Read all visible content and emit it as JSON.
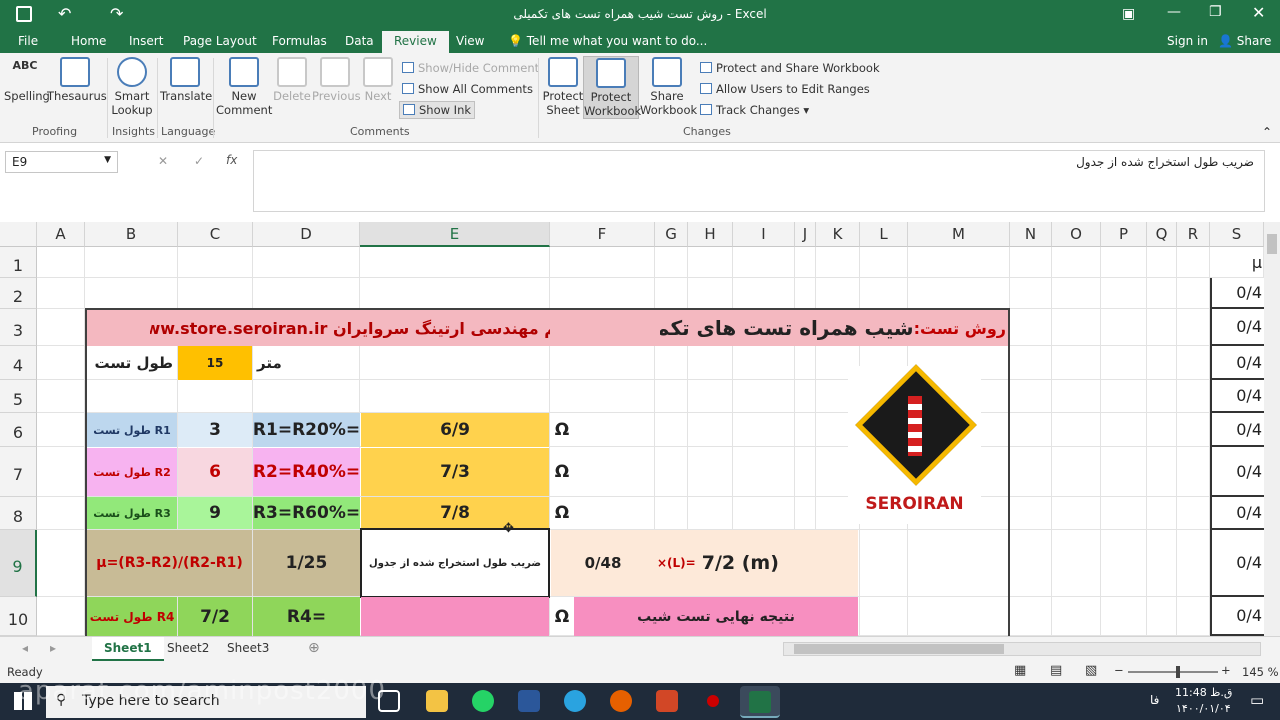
{
  "title": "روش تست شیب همراه تست های تکمیلی - Excel",
  "tabs": [
    "File",
    "Home",
    "Insert",
    "Page Layout",
    "Formulas",
    "Data",
    "Review",
    "View"
  ],
  "tell_me": "Tell me what you want to do...",
  "sign_in": "Sign in",
  "share": "Share",
  "ribbon": {
    "spelling": "Spelling",
    "thesaurus": "Thesaurus",
    "smart_lookup_1": "Smart",
    "smart_lookup_2": "Lookup",
    "translate": "Translate",
    "new_comment_1": "New",
    "new_comment_2": "Comment",
    "delete": "Delete",
    "previous": "Previous",
    "next": "Next",
    "show_hide": "Show/Hide Comment",
    "show_all": "Show All Comments",
    "show_ink": "Show Ink",
    "protect_sheet_1": "Protect",
    "protect_sheet_2": "Sheet",
    "protect_wb_1": "Protect",
    "protect_wb_2": "Workbook",
    "share_wb_1": "Share",
    "share_wb_2": "Workbook",
    "protect_share": "Protect and Share Workbook",
    "allow_users": "Allow Users to Edit Ranges",
    "track_changes": "Track Changes",
    "groups": {
      "proofing": "Proofing",
      "insights": "Insights",
      "language": "Language",
      "comments": "Comments",
      "changes": "Changes"
    },
    "abc": "ABC"
  },
  "name_box": "E9",
  "formula": "ضریب طول  استخراج شده از جدول",
  "columns": [
    "A",
    "B",
    "C",
    "D",
    "E",
    "F",
    "G",
    "H",
    "I",
    "J",
    "K",
    "L",
    "M",
    "N",
    "O",
    "P",
    "Q",
    "R",
    "S"
  ],
  "rows": [
    "1",
    "2",
    "3",
    "4",
    "5",
    "6",
    "7",
    "8",
    "9",
    "10"
  ],
  "sheet": {
    "header_left": "www.store.seroiran.ir  تیم مهندسی ارتینگ سروایران",
    "header_prefix": "روش تست:",
    "header_right": "شیب همراه تست های تکمیلی",
    "test_length_label": "طول تست",
    "test_length_value": "15",
    "unit_meter": "متر",
    "r1_label": "طول تست R1",
    "r1_val": "3",
    "r1_formula": "R1=R20%=",
    "r1_res": "6/9",
    "r2_label": "طول تست R2",
    "r2_val": "6",
    "r2_formula": "R2=R40%=",
    "r2_res": "7/3",
    "r3_label": "طول تست R3",
    "r3_val": "9",
    "r3_formula": "R3=R60%=",
    "r3_res": "7/8",
    "ohm": "Ω",
    "mu_formula": "µ=(R3-R2)/(R2-R1)",
    "mu_val": "1/25",
    "coef_label": "ضریب طول  استخراج شده از جدول",
    "coef_val": "0/48",
    "xl_label": "×(L)=",
    "xl_val": "7/2  (m)",
    "r4_label": "طول تست R4",
    "r4_len": "7/2",
    "r4_formula": "R4=",
    "final_label": "نتیجه نهایی تست شیب",
    "logo_text": "SEROIRAN",
    "s_col": [
      "µ",
      "0/4",
      "0/4",
      "0/4",
      "0/4",
      "0/4",
      "0/4",
      "0/4",
      "0/4",
      "0/4"
    ]
  },
  "sheet_tabs": [
    "Sheet1",
    "Sheet2",
    "Sheet3"
  ],
  "status": {
    "ready": "Ready",
    "zoom": "145 %"
  },
  "taskbar": {
    "search": "Type here to search",
    "time": "11:48 ق.ظ",
    "date": "۱۴۰۰/۰۱/۰۴",
    "lang": "فا"
  },
  "watermark": "aparat.com/aminpost2000"
}
